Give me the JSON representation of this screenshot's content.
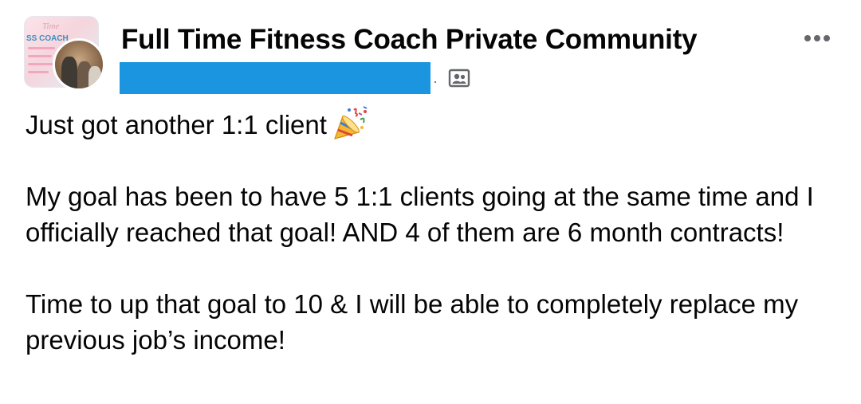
{
  "header": {
    "group_name": "Full Time Fitness Coach Private Community",
    "group_cover_text": "SS COACH",
    "group_cover_script": "Time",
    "privacy_icon": "group-members-icon",
    "more_icon": "more-options-icon"
  },
  "post": {
    "line1": "Just got another 1:1 client",
    "line1_emoji": "party-popper-icon",
    "paragraph2": "My goal has been to have 5 1:1 clients going at the same time and I officially reached that goal! AND 4 of them are 6 month contracts!",
    "paragraph3": "Time to up that goal to 10 & I will be able to completely replace my previous job’s income!"
  },
  "colors": {
    "redaction": "#1b95e0",
    "text": "#050505",
    "secondary": "#65676b"
  }
}
